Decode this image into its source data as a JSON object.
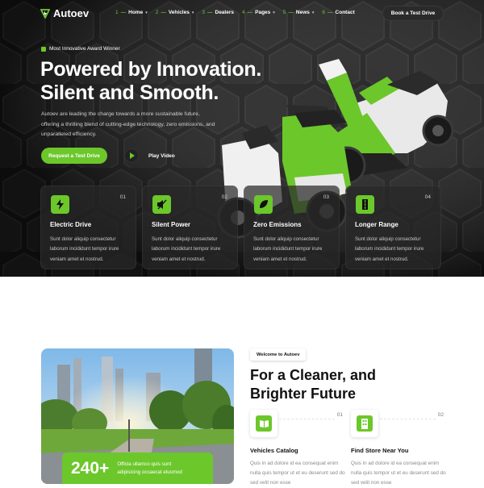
{
  "nav": {
    "logo": "Autoev",
    "items": [
      {
        "num": "1",
        "label": "Home",
        "has_dropdown": true
      },
      {
        "num": "2",
        "label": "Vehicles",
        "has_dropdown": true
      },
      {
        "num": "3",
        "label": "Dealers",
        "has_dropdown": false
      },
      {
        "num": "4",
        "label": "Pages",
        "has_dropdown": true
      },
      {
        "num": "5",
        "label": "News",
        "has_dropdown": true
      },
      {
        "num": "6",
        "label": "Contact",
        "has_dropdown": false
      }
    ],
    "cta": "Book a Test Drive"
  },
  "hero": {
    "award": "Most Innovative Award Winner",
    "title_line1": "Powered by Innovation.",
    "title_line2": "Silent and Smooth.",
    "description": "Autoev are leading the charge towards a more sustainable future, offering a thrilling blend of cutting-edge technology, zero emissions, and unparalleled efficiency.",
    "primary_button": "Request a Test Drive",
    "video_button": "Play Video"
  },
  "features": [
    {
      "num": "01",
      "title": "Electric Drive",
      "icon": "lightning-icon",
      "desc": "Sunt dolor aliquip consectetur laborum incididunt tempor irure veniam amet et nostrud."
    },
    {
      "num": "02",
      "title": "Silent Power",
      "icon": "mute-speaker-icon",
      "desc": "Sunt dolor aliquip consectetur laborum incididunt tempor irure veniam amet et nostrud."
    },
    {
      "num": "03",
      "title": "Zero Emissions",
      "icon": "leaf-icon",
      "desc": "Sunt dolor aliquip consectetur laborum incididunt tempor irure veniam amet et nostrud."
    },
    {
      "num": "04",
      "title": "Longer Range",
      "icon": "road-icon",
      "desc": "Sunt dolor aliquip consectetur laborum incididunt tempor irure veniam amet et nostrud."
    }
  ],
  "about": {
    "badge": "Welcome to Autoev",
    "title_line1": "For a Cleaner, and",
    "title_line2": "Brighter Future",
    "stat_value": "240+",
    "stat_text": "Officia ullamco quis sunt adipisicing occaecat elusmod",
    "cards": [
      {
        "num": "01",
        "title": "Vehicles Catalog",
        "icon": "catalog-book-icon",
        "desc": "Quis in ad dolore id ea consequat enim nulla quis tempor ut et eu deserunt sed do sed velit non esse"
      },
      {
        "num": "02",
        "title": "Find Store Near You",
        "icon": "store-building-icon",
        "desc": "Quis in ad dolore id ea consequat enim nulla quis tempor ut et eu deserunt sed do sed velit non esse"
      }
    ]
  },
  "colors": {
    "accent": "#6cc72b",
    "dark": "#121212",
    "text": "#111111"
  }
}
